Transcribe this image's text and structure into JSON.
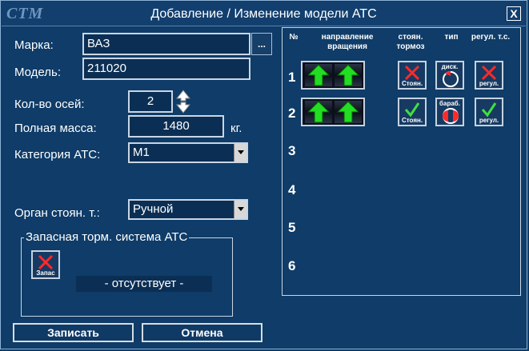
{
  "window": {
    "logo": "СТМ",
    "title": "Добавление / Изменение модели АТС",
    "close_label": "X"
  },
  "form": {
    "make_label": "Марка:",
    "make_value": "ВАЗ",
    "make_browse": "...",
    "model_label": "Модель:",
    "model_value": "211020",
    "axles_label": "Кол-во осей:",
    "axles_value": "2",
    "mass_label": "Полная масса:",
    "mass_value": "1480",
    "mass_unit": "кг.",
    "category_label": "Категория АТС:",
    "category_value": "M1",
    "parking_label": "Орган стоян. т.:",
    "parking_value": "Ручной"
  },
  "reserve": {
    "title": "Запасная торм. система АТС",
    "button_label": "Запас",
    "status": "- отсутствует -"
  },
  "buttons": {
    "save": "Записать",
    "cancel": "Отмена"
  },
  "axles_table": {
    "headers": {
      "num": "№",
      "direction": "направление вращения",
      "parking": "стоян. тормоз",
      "type": "тип",
      "regul": "регул. т.с."
    },
    "rows": [
      {
        "num": "1",
        "parking": "Стоян.",
        "parking_state": "off",
        "type": "диск.",
        "regul": "регул.",
        "regul_state": "off"
      },
      {
        "num": "2",
        "parking": "Стоян.",
        "parking_state": "on",
        "type": "бараб.",
        "regul": "регул.",
        "regul_state": "on"
      },
      {
        "num": "3"
      },
      {
        "num": "4"
      },
      {
        "num": "5"
      },
      {
        "num": "6"
      }
    ]
  },
  "colors": {
    "background": "#0f3c68",
    "field": "#0b2f54",
    "check": "#3fe03f",
    "cross": "#ff2a2a",
    "arrow": "#22dd22"
  }
}
